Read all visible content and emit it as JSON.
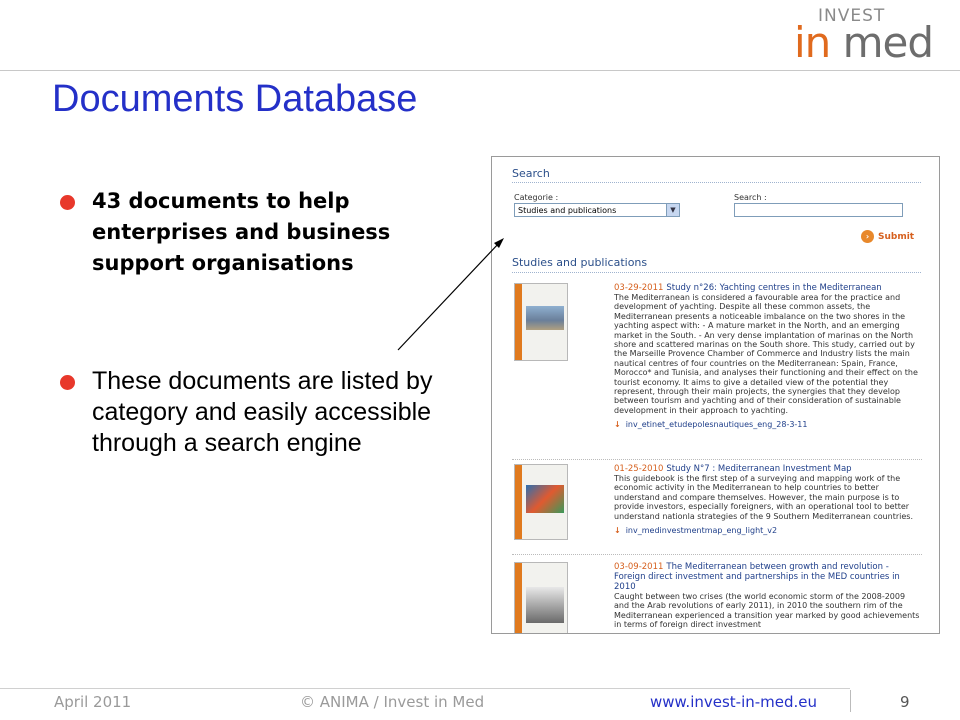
{
  "logo": {
    "top": "INVEST",
    "main_left": "in",
    "main_right": " med"
  },
  "slide": {
    "title": "Documents Database"
  },
  "bullets": [
    {
      "text": "43 documents to help enterprises and business support organisations"
    },
    {
      "text": "These documents are listed by category and easily accessible through a search engine"
    }
  ],
  "colors": {
    "title": "#2430c8",
    "bullet": "#e8382b",
    "accent": "#e06a1e",
    "link": "#2430c8"
  },
  "screenshot": {
    "search_heading": "Search",
    "category_label": "Categorie :",
    "category_value": "Studies and publications",
    "search_label": "Search :",
    "search_value": "",
    "submit_label": "Submit",
    "results_heading": "Studies and publications",
    "documents": [
      {
        "date": "03-29-2011",
        "title": "Study n°26: Yachting centres in the Mediterranean",
        "description": "The Mediterranean is considered a favourable area for the practice and development of yachting. Despite all these common assets, the Mediterranean presents a noticeable imbalance on the two shores in the yachting aspect with: - A mature market in the North, and an emerging market in the South. - An very dense implantation of marinas on the North shore and scattered marinas on the South shore. This study, carried out by the Marseille Provence Chamber of Commerce and Industry lists the main nautical centres of four countries on the Mediterranean: Spain, France, Morocco* and Tunisia, and analyses their functioning and their effect on the tourist economy. It aims to give a detailed view of the potential they represent, through their main projects, the synergies that they develop between tourism and yachting and of their consideration of sustainable development in their approach to yachting.",
        "file": "inv_etinet_etudepolesnautiques_eng_28-3-11"
      },
      {
        "date": "01-25-2010",
        "title": "Study N°7 : Mediterranean Investment Map",
        "description": "This guidebook is the first step of a surveying and mapping work of the economic activity in the Mediterranean to help countries to better understand and compare themselves. However, the main purpose is to provide investors, especially foreigners, with an operational tool to better understand nationla strategies of the 9 Southern Mediterranean countries.",
        "file": "inv_medinvestmentmap_eng_light_v2"
      },
      {
        "date": "03-09-2011",
        "title": "The Mediterranean between growth and revolution - Foreign direct investment and partnerships in the MED countries in 2010",
        "description": "Caught between two crises (the world economic storm of the 2008-2009 and the Arab revolutions of early 2011), in 2010 the southern rim of the Mediterranean experienced a transition year marked by good achievements in terms of foreign direct investment",
        "file": ""
      }
    ]
  },
  "footer": {
    "date": "April 2011",
    "copyright": "© ANIMA / Invest in Med",
    "url": "www.invest-in-med.eu",
    "page": "9"
  }
}
